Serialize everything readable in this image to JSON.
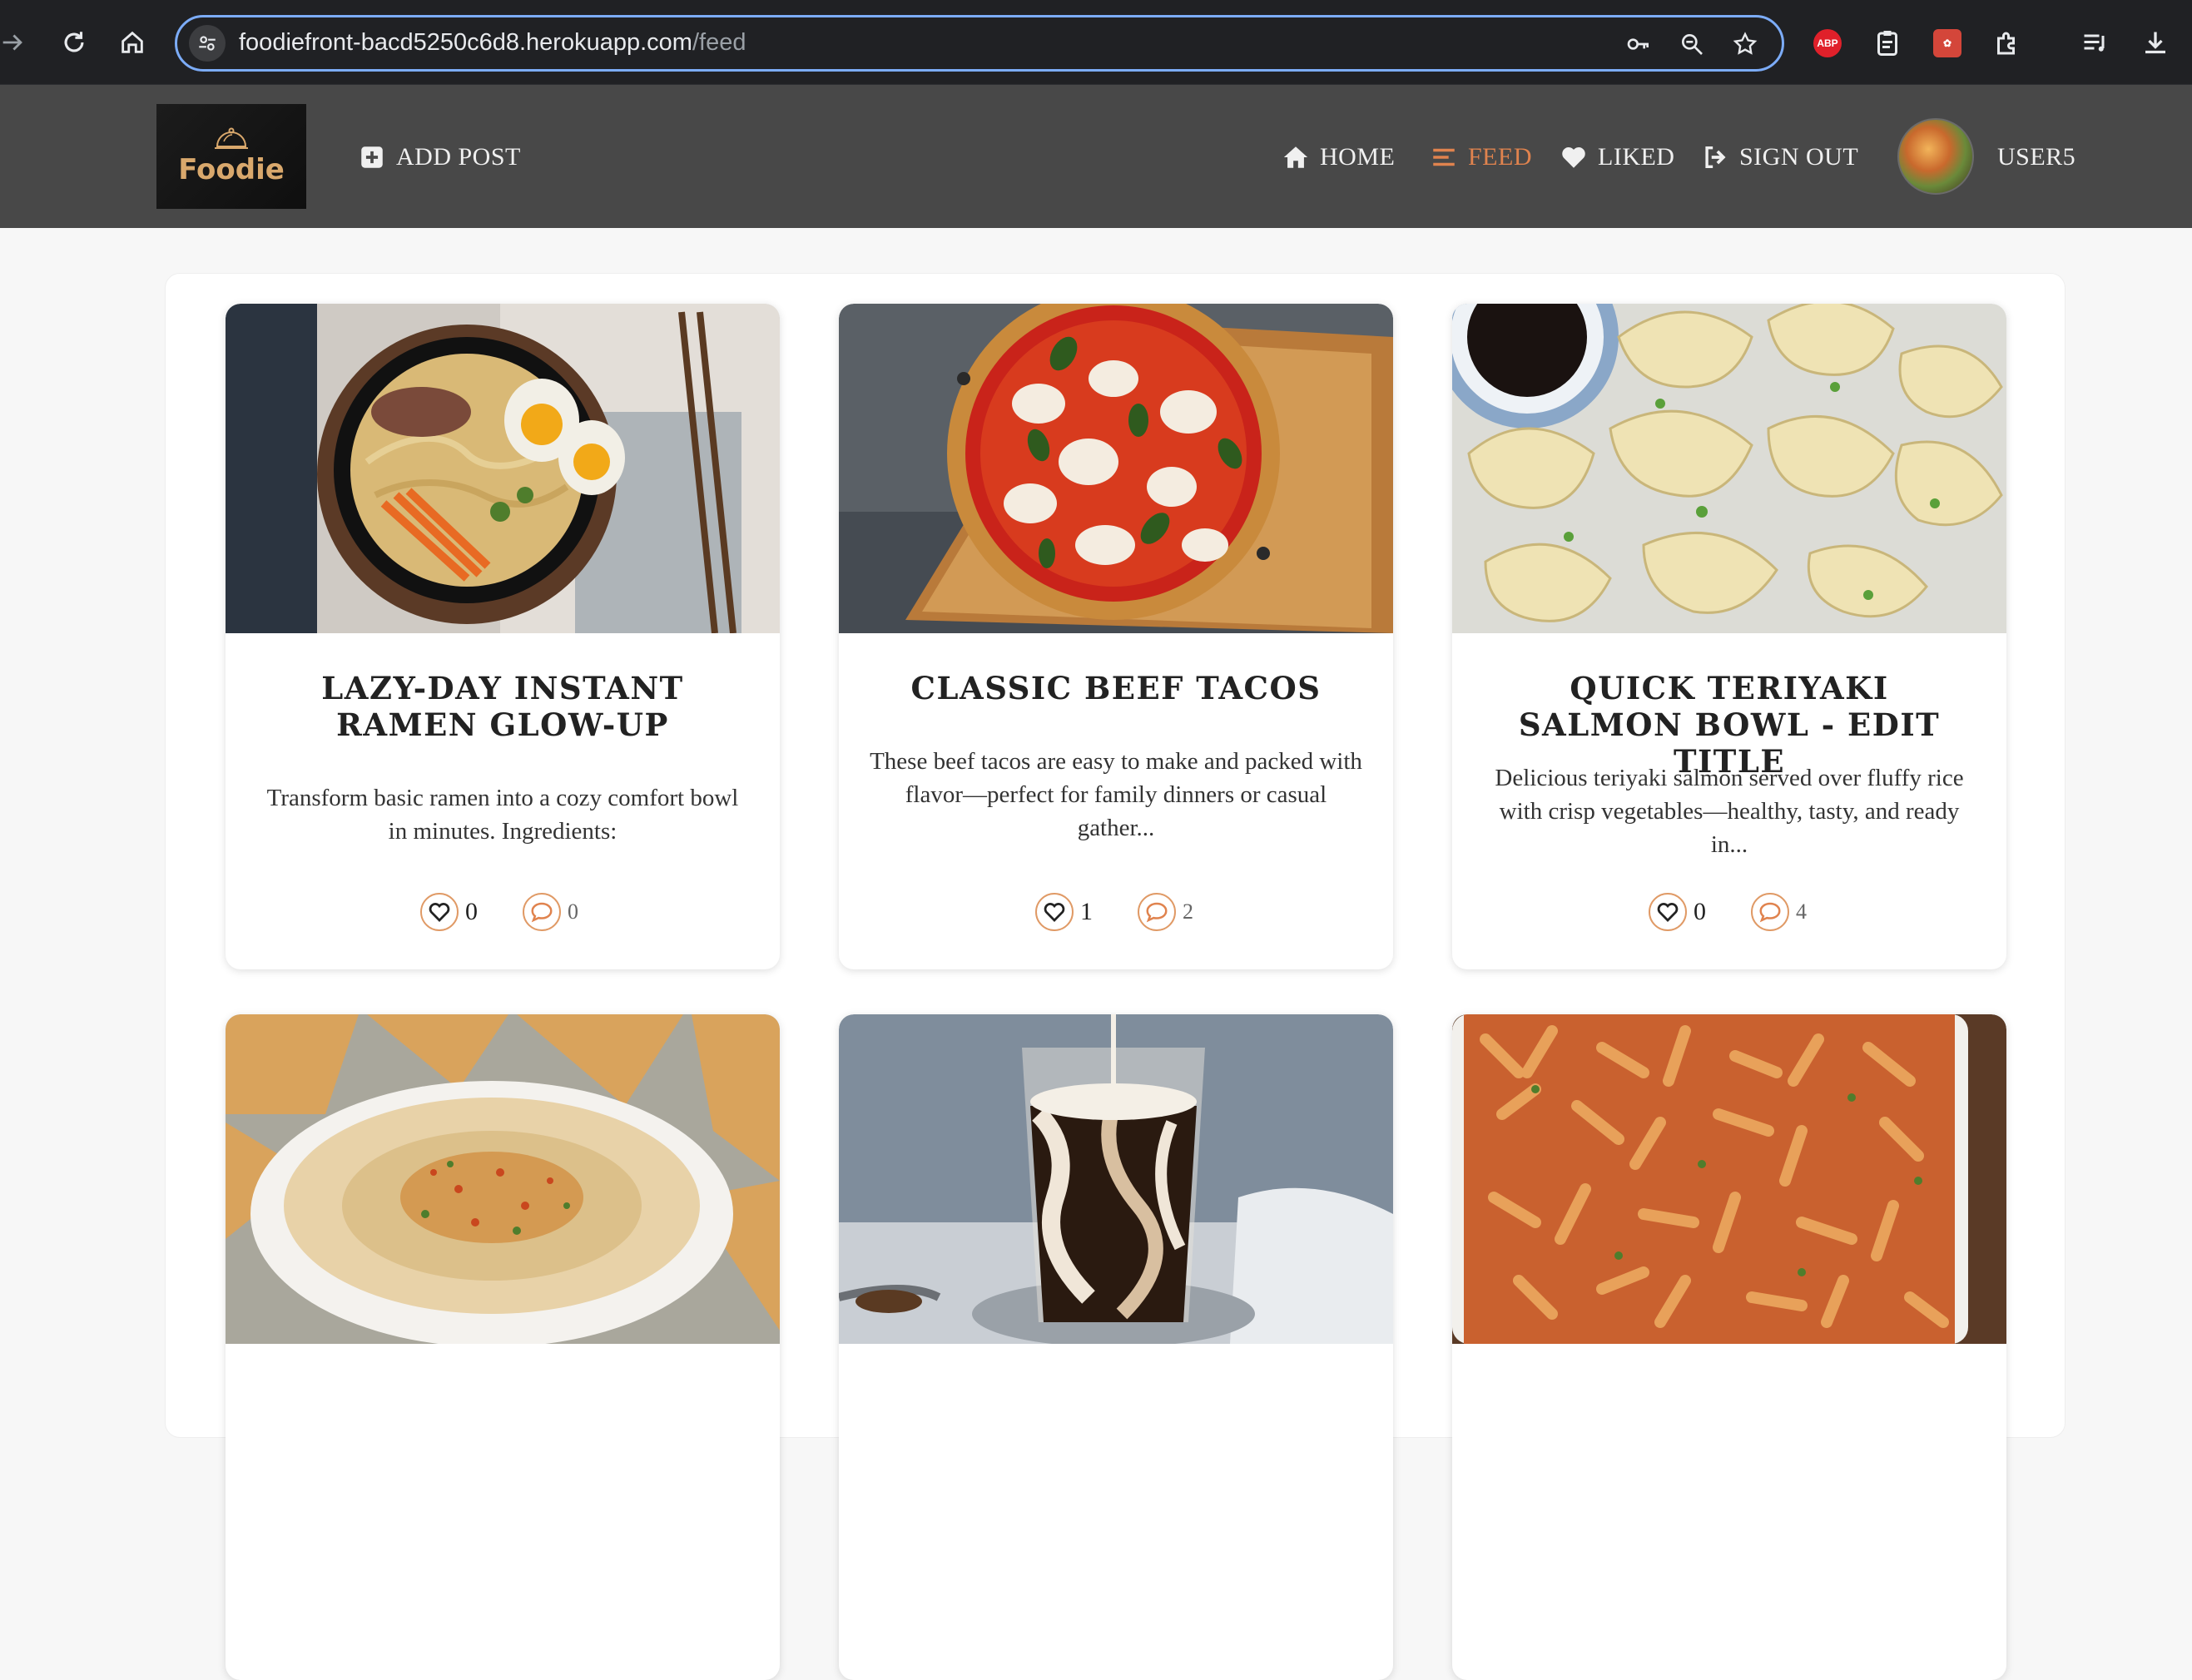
{
  "browser": {
    "url_host": "foodiefront-bacd5250c6d8.herokuapp.com",
    "url_path": "/feed",
    "extensions": {
      "abp_label": "ABP"
    }
  },
  "header": {
    "logo_text": "Foodie",
    "add_post_label": "ADD POST",
    "nav": {
      "home": "HOME",
      "feed": "FEED",
      "liked": "LIKED",
      "sign_out": "SIGN OUT"
    },
    "username": "USER5",
    "accent_color": "#e0834e"
  },
  "posts": [
    {
      "title": "LAZY-DAY INSTANT RAMEN GLOW-UP",
      "description": "Transform basic ramen into a cozy comfort bowl in minutes. Ingredients:",
      "likes": "0",
      "comments": "0",
      "image": "ramen-bowl-photo"
    },
    {
      "title": "CLASSIC BEEF TACOS",
      "description": "These beef tacos are easy to make and packed with flavor—perfect for family dinners or casual gather...",
      "likes": "1",
      "comments": "2",
      "image": "margherita-pizza-photo"
    },
    {
      "title": "QUICK TERIYAKI SALMON BOWL - EDIT TITLE",
      "description": "Delicious teriyaki salmon served over fluffy rice with crisp vegetables—healthy, tasty, and ready in...",
      "likes": "0",
      "comments": "4",
      "image": "dumplings-photo"
    },
    {
      "image": "hummus-photo"
    },
    {
      "image": "iced-coffee-photo"
    },
    {
      "image": "baked-pasta-photo"
    }
  ]
}
